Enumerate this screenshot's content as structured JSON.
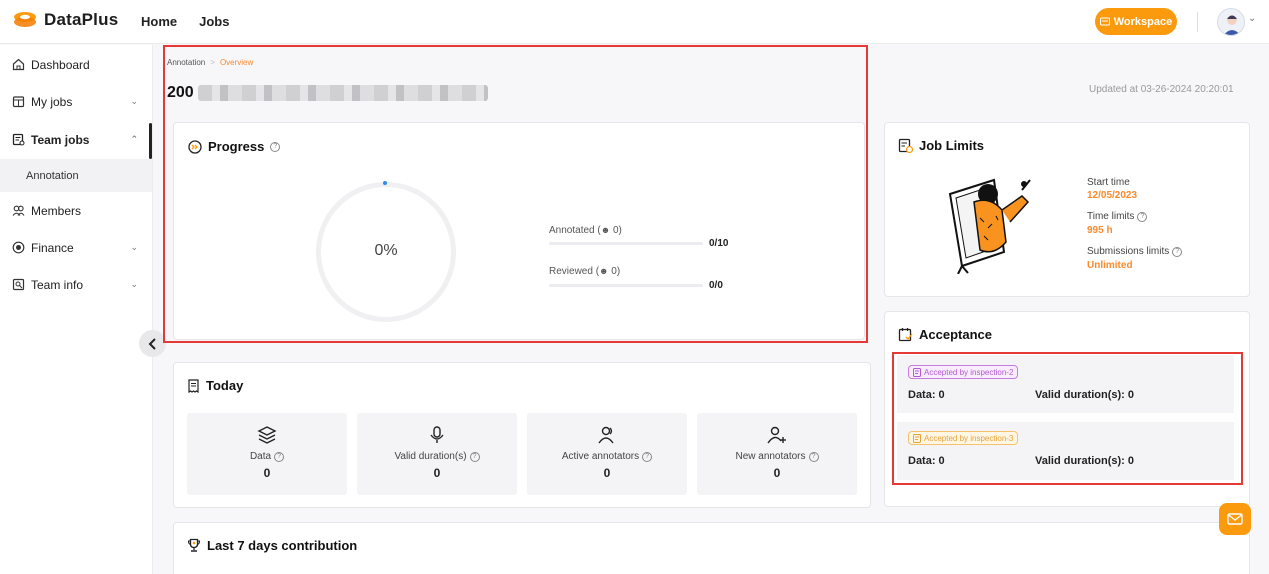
{
  "app": {
    "name": "DataPlus",
    "nav": [
      "Home",
      "Jobs"
    ],
    "workspace_label": "Workspace"
  },
  "sidebar": {
    "items": [
      {
        "label": "Dashboard",
        "icon": "home-icon"
      },
      {
        "label": "My jobs",
        "icon": "calendar-icon"
      },
      {
        "label": "Team jobs",
        "icon": "team-jobs-icon"
      },
      {
        "label": "Members",
        "icon": "members-icon"
      },
      {
        "label": "Finance",
        "icon": "finance-icon"
      },
      {
        "label": "Team info",
        "icon": "team-info-icon"
      }
    ],
    "sub_item": "Annotation"
  },
  "header": {
    "breadcrumb": [
      "Annotation",
      "Overview"
    ],
    "title_prefix": "200",
    "updated": "Updated at 03-26-2024 20:20:01"
  },
  "progress": {
    "title": "Progress",
    "percent_label": "0%",
    "percent": 0,
    "annotated_label": "Annotated (",
    "annotated_count": "0)",
    "annotated_value": "0/10",
    "reviewed_label": "Reviewed (",
    "reviewed_count": "0)",
    "reviewed_value": "0/0"
  },
  "today": {
    "title": "Today",
    "tiles": [
      {
        "label": "Data",
        "value": "0",
        "icon": "layers-icon"
      },
      {
        "label": "Valid duration(s)",
        "value": "0",
        "icon": "microphone-icon"
      },
      {
        "label": "Active annotators",
        "value": "0",
        "icon": "users-icon"
      },
      {
        "label": "New annotators",
        "value": "0",
        "icon": "user-plus-icon"
      }
    ]
  },
  "job_limits": {
    "title": "Job Limits",
    "start_time_label": "Start time",
    "start_time": "12/05/2023",
    "time_limits_label": "Time limits",
    "time_limits": "995 h",
    "submissions_label": "Submissions limits",
    "submissions": "Unlimited"
  },
  "acceptance": {
    "title": "Acceptance",
    "rows": [
      {
        "badge": "Accepted by inspection-2",
        "data": "Data: 0",
        "duration": "Valid duration(s): 0"
      },
      {
        "badge": "Accepted by inspection-3",
        "data": "Data: 0",
        "duration": "Valid duration(s): 0"
      }
    ]
  },
  "contribution": {
    "title": "Last 7 days contribution"
  },
  "colors": {
    "accent": "#fb9a0d",
    "highlight": "#e53935"
  }
}
